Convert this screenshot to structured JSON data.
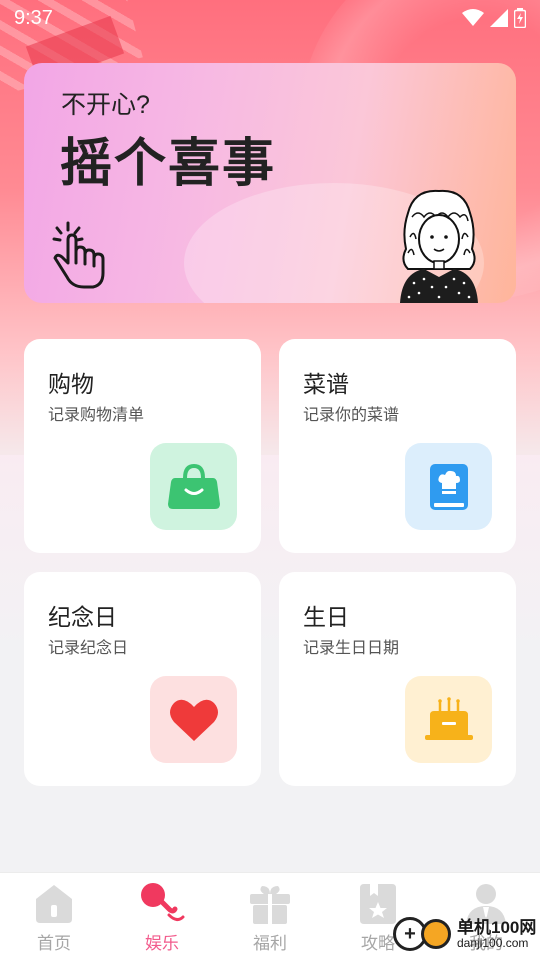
{
  "status_bar": {
    "time": "9:37",
    "watermark": ""
  },
  "banner": {
    "subtitle": "不开心?",
    "title": "摇个喜事"
  },
  "cards": [
    {
      "id": "shopping",
      "title": "购物",
      "desc": "记录购物清单",
      "icon": "shopping-bag-icon",
      "icon_bg": "#cff3df",
      "icon_color": "#3cc472"
    },
    {
      "id": "recipe",
      "title": "菜谱",
      "desc": "记录你的菜谱",
      "icon": "recipe-book-icon",
      "icon_bg": "#dceefc",
      "icon_color": "#2f9bf0"
    },
    {
      "id": "anniversary",
      "title": "纪念日",
      "desc": "记录纪念日",
      "icon": "heart-icon",
      "icon_bg": "#fde0e0",
      "icon_color": "#ef3a3a"
    },
    {
      "id": "birthday",
      "title": "生日",
      "desc": "记录生日日期",
      "icon": "birthday-cake-icon",
      "icon_bg": "#fff0d2",
      "icon_color": "#f7b21a"
    }
  ],
  "bottom_nav": [
    {
      "label": "首页",
      "icon": "home-icon",
      "active": false
    },
    {
      "label": "娱乐",
      "icon": "microphone-icon",
      "active": true
    },
    {
      "label": "福利",
      "icon": "gift-icon",
      "active": false
    },
    {
      "label": "攻略",
      "icon": "bookmark-star-icon",
      "active": false
    },
    {
      "label": "我的",
      "icon": "user-icon",
      "active": false
    }
  ],
  "site_logo": {
    "line1": "单机100网",
    "line2": "danji100.com"
  },
  "colors": {
    "accent": "#f25b8c",
    "nav_inactive": "#a6a6a6"
  }
}
